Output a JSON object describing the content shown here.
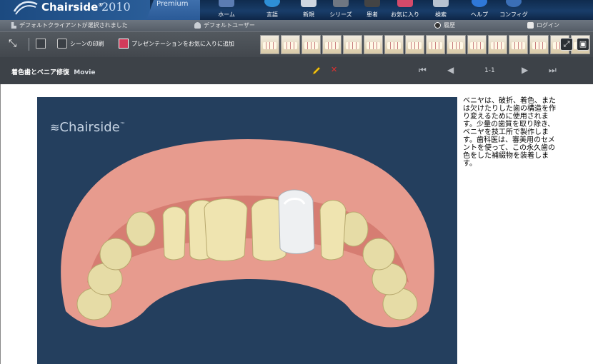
{
  "header": {
    "logo_text": "Chairside",
    "logo_tm": "®",
    "logo_year": "2010",
    "premium": "Premium",
    "nav": [
      {
        "label": "ホーム",
        "icon": "home-icon",
        "color": "#5b7cb2"
      },
      {
        "label": "言語",
        "icon": "globe-icon",
        "color": "#2e8fd6"
      },
      {
        "label": "新規",
        "icon": "new-icon",
        "color": "#cfd6df"
      },
      {
        "label": "シリーズ",
        "icon": "film-icon",
        "color": "#6f7782"
      },
      {
        "label": "患者",
        "icon": "patient-icon",
        "color": "#444"
      },
      {
        "label": "お気に入り",
        "icon": "favorite-icon",
        "color": "#d44a6a"
      },
      {
        "label": "検索",
        "icon": "search-icon",
        "color": "#b8c3d0"
      },
      {
        "label": "ヘルプ",
        "icon": "help-icon",
        "color": "#2f78d8"
      },
      {
        "label": "コンフィグ",
        "icon": "config-icon",
        "color": "#3b6fb6"
      }
    ]
  },
  "status": {
    "client": "デフォルトクライアントが選択されました",
    "user": "デフォルトユーザー",
    "history": "履歴",
    "login": "ログイン"
  },
  "toolbar": {
    "print_label": "シーンの印刷",
    "favorite_label": "プレゼンテーションをお気に入りに追加",
    "thumb_count": 16
  },
  "title": {
    "name": "着色歯とベニア修復",
    "type": "Movie",
    "page": "1-1"
  },
  "movie": {
    "logo": "Chairside",
    "logo_tm": "™"
  },
  "description": "ベニヤは、破折、着色、または欠けたりした歯の構造を作り変えるために使用されます。少量の歯質を取り除き、ベニヤを技工所で製作します。歯科医は、審美用のセメントを使って、この永久歯の色をした補綴物を装着します。"
}
